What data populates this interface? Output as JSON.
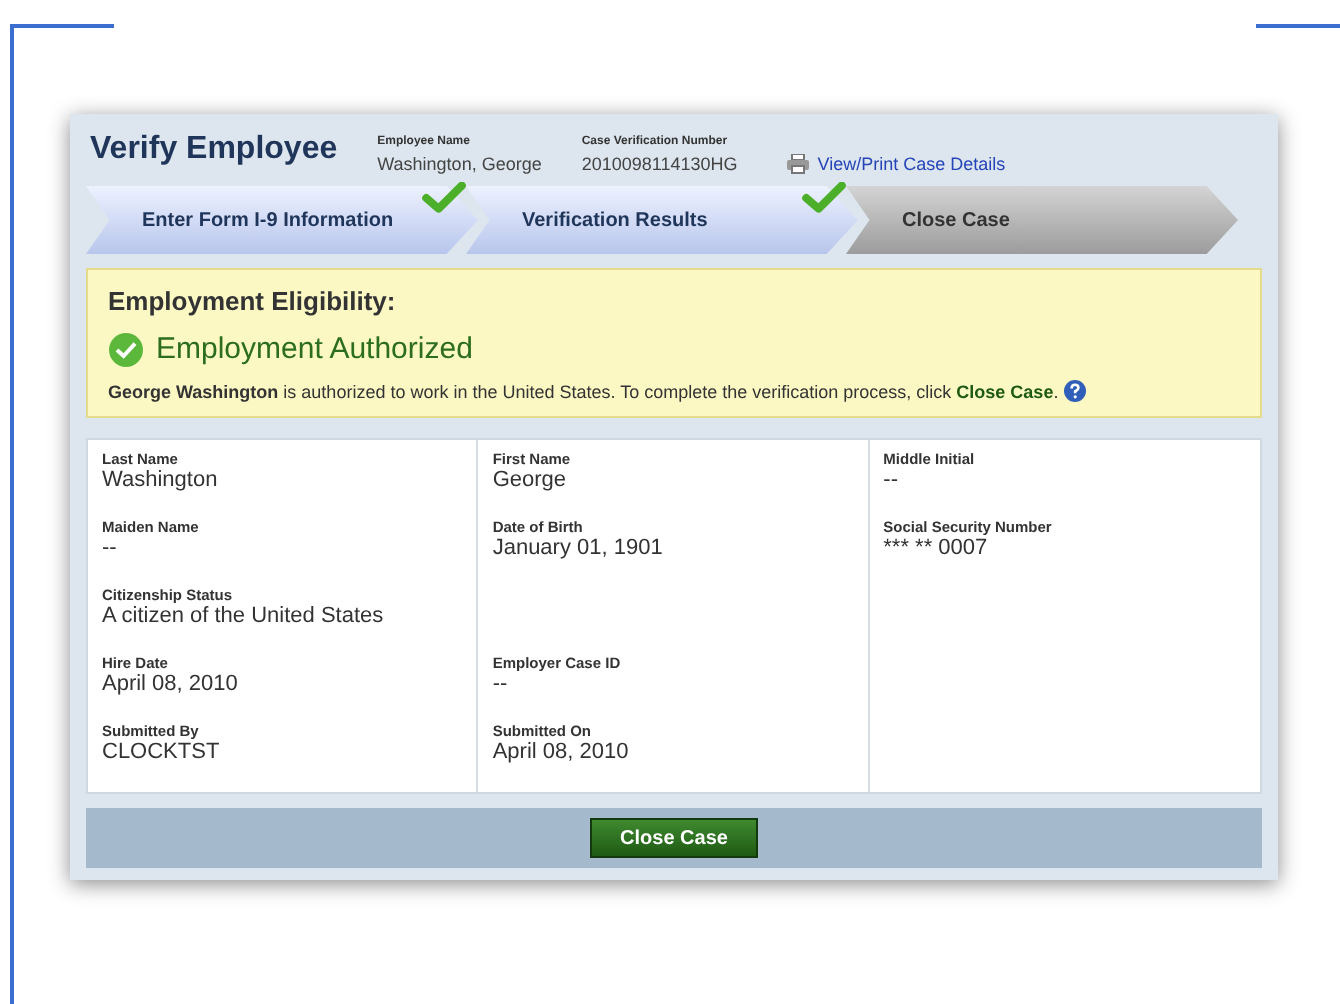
{
  "header": {
    "title": "Verify Employee",
    "employee_name": {
      "label": "Employee Name",
      "value": "Washington, George"
    },
    "case_number": {
      "label": "Case Verification Number",
      "value": "2010098114130HG"
    },
    "print_link": "View/Print Case Details"
  },
  "steps": [
    {
      "label": "Enter Form I-9 Information",
      "completed": true,
      "selected": false
    },
    {
      "label": "Verification Results",
      "completed": true,
      "selected": false
    },
    {
      "label": "Close Case",
      "completed": false,
      "selected": true
    }
  ],
  "eligibility": {
    "heading": "Employment Eligibility:",
    "status": "Employment Authorized",
    "message": "**George Washington** is authorized to work in the United States. To complete the verification process, click **Close Case**."
  },
  "details": [
    [
      {
        "kind": "single",
        "label": "Last Name",
        "value": "Washington"
      },
      {
        "kind": "single",
        "label": "Maiden Name",
        "value": "--"
      },
      {
        "kind": "single",
        "label": "Citizenship Status",
        "value": "A citizen of the United States"
      },
      {
        "kind": "single",
        "label": "Hire Date",
        "value": "April 08, 2010"
      },
      {
        "kind": "single",
        "label": "Submitted By",
        "value": "CLOCKTST"
      }
    ],
    [
      {
        "kind": "single",
        "label": "First Name",
        "value": "George"
      },
      {
        "kind": "double",
        "label": "Date of Birth",
        "value": "January 01, 1901"
      },
      {
        "kind": "single",
        "label": "Employer Case ID",
        "value": "--"
      },
      {
        "kind": "single",
        "label": "Submitted On",
        "value": "April 08, 2010"
      }
    ],
    [
      {
        "kind": "single",
        "label": "Middle Initial",
        "value": "--"
      },
      {
        "kind": "single",
        "label": "Social Security Number",
        "value": "*** ** 0007"
      }
    ]
  ],
  "close_button": "Close Case"
}
